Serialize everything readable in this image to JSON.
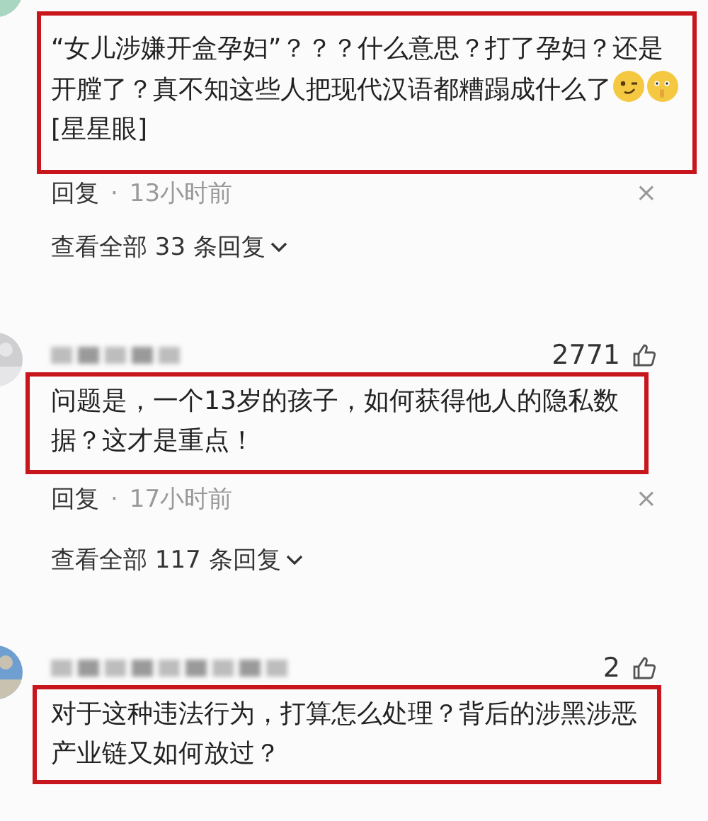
{
  "comments": [
    {
      "avatar": {
        "kind": "green"
      },
      "content": [
        {
          "kind": "text",
          "text": "“女儿涉嫌开盒孕妇”？？？什么意思？打了孕妇？还是开膛了？真不知这些人把现代汉语都糟蹋成什么了"
        },
        {
          "kind": "wink"
        },
        {
          "kind": "shush"
        },
        {
          "kind": "text",
          "text": "[星星眼]"
        }
      ],
      "reply": "回复",
      "separator": "·",
      "time": "13小时前",
      "close": "×",
      "view_all": "查看全部 33 条回复",
      "highlighted": true
    },
    {
      "avatar": {
        "kind": "grey"
      },
      "likes": "2771",
      "content": [
        {
          "kind": "text",
          "text": "问题是，一个13岁的孩子，如何获得他人的隐私数据？这才是重点！"
        }
      ],
      "reply": "回复",
      "separator": "·",
      "time": "17小时前",
      "close": "×",
      "view_all": "查看全部 117 条回复",
      "highlighted": true
    },
    {
      "avatar": {
        "kind": "blue"
      },
      "likes": "2",
      "content": [
        {
          "kind": "text",
          "text": "对于这种违法行为，打算怎么处理？背后的涉黑涉恶产业链又如何放过？"
        }
      ],
      "highlighted": true
    }
  ]
}
